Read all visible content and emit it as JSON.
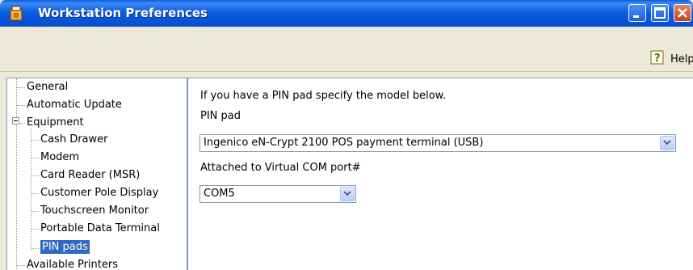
{
  "window": {
    "title": "Workstation Preferences"
  },
  "toolbar": {
    "help_label": "Help"
  },
  "tree": {
    "items": [
      {
        "label": "General"
      },
      {
        "label": "Automatic Update"
      },
      {
        "label": "Equipment"
      },
      {
        "label": "Cash Drawer"
      },
      {
        "label": "Modem"
      },
      {
        "label": "Card Reader (MSR)"
      },
      {
        "label": "Customer Pole Display"
      },
      {
        "label": "Touchscreen Monitor"
      },
      {
        "label": "Portable Data Terminal"
      },
      {
        "label": "PIN pads"
      },
      {
        "label": "Available Printers"
      }
    ],
    "selected": "PIN pads"
  },
  "panel": {
    "intro": "If you have a PIN pad specify the model below.",
    "pinpad_label": "PIN pad",
    "pinpad_value": "Ingenico eN-Crypt 2100 POS payment terminal (USB)",
    "com_label": "Attached to Virtual COM port#",
    "com_value": "COM5"
  },
  "icons": {
    "app": "app-icon",
    "help": "help-icon",
    "dropdown": "chevron-down-icon"
  }
}
